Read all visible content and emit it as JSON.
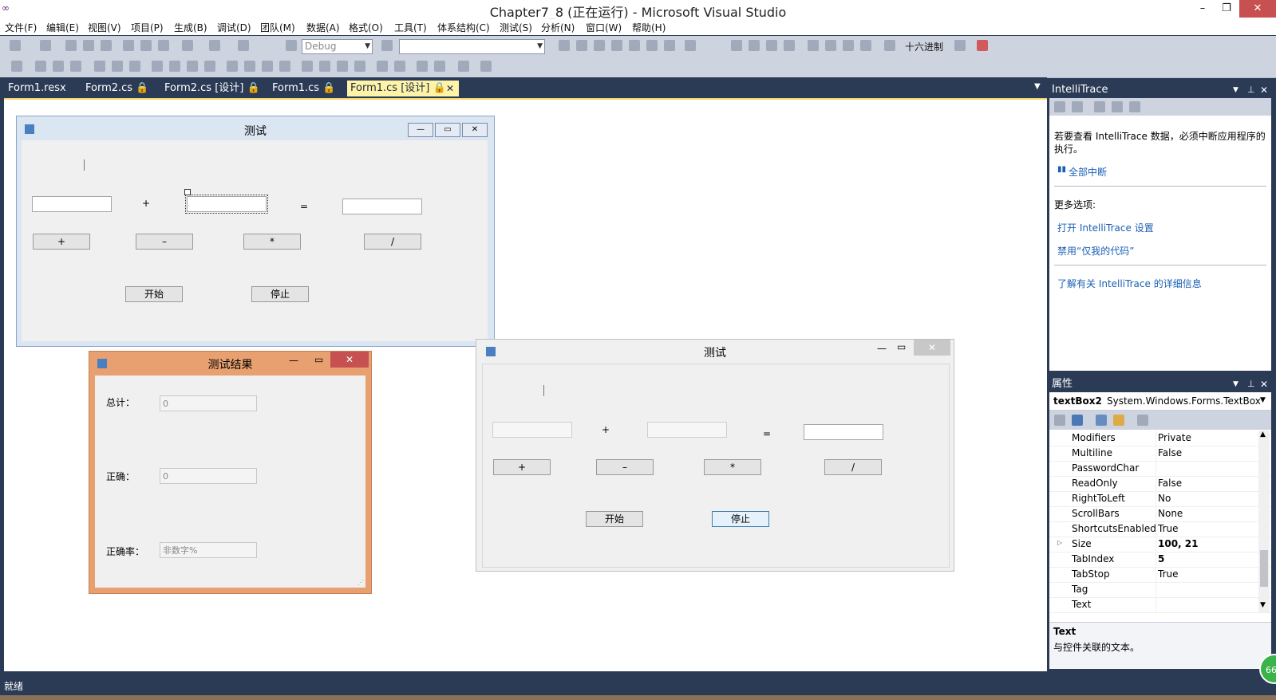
{
  "window": {
    "title": "Chapter7_8 (正在运行) - Microsoft Visual Studio",
    "min": "–",
    "max": "❐",
    "close": "✕"
  },
  "menu": [
    "文件(F)",
    "编辑(E)",
    "视图(V)",
    "项目(P)",
    "生成(B)",
    "调试(D)",
    "团队(M)",
    "数据(A)",
    "格式(O)",
    "工具(T)",
    "体系结构(C)",
    "测试(S)",
    "分析(N)",
    "窗口(W)",
    "帮助(H)"
  ],
  "toolbar": {
    "config": "Debug",
    "hex_label": "十六进制"
  },
  "tabs": [
    {
      "label": "Form1.resx",
      "active": false
    },
    {
      "label": "Form2.cs 🔒",
      "active": false
    },
    {
      "label": "Form2.cs [设计] 🔒",
      "active": false
    },
    {
      "label": "Form1.cs 🔒",
      "active": false
    },
    {
      "label": "Form1.cs [设计] 🔒",
      "active": true
    }
  ],
  "tab_close": "✕",
  "design_form": {
    "title": "测试",
    "plus_label": "+",
    "equals_label": "=",
    "btn_add": "+",
    "btn_sub": "–",
    "btn_mul": "*",
    "btn_div": "/",
    "btn_start": "开始",
    "btn_stop": "停止"
  },
  "result_form": {
    "title": "测试结果",
    "total_label": "总计：",
    "total_value": "0",
    "correct_label": "正确：",
    "correct_value": "0",
    "rate_label": "正确率：",
    "rate_value": "非数字%"
  },
  "run_form": {
    "title": "测试",
    "plus_label": "+",
    "equals_label": "=",
    "btn_add": "+",
    "btn_sub": "–",
    "btn_mul": "*",
    "btn_div": "/",
    "btn_start": "开始",
    "btn_stop": "停止"
  },
  "intellitrace": {
    "title": "IntelliTrace",
    "message": "若要查看 IntelliTrace 数据，必须中断应用程序的执行。",
    "break_all": "全部中断",
    "more_options": "更多选项:",
    "open_settings": "打开 IntelliTrace 设置",
    "disable_jmc": "禁用“仅我的代码”",
    "learn_more": "了解有关 IntelliTrace 的详细信息"
  },
  "properties": {
    "title": "属性",
    "object_name": "textBox2",
    "object_type": "System.Windows.Forms.TextBox",
    "rows": [
      {
        "name": "Modifiers",
        "value": "Private",
        "bold": false
      },
      {
        "name": "Multiline",
        "value": "False",
        "bold": false
      },
      {
        "name": "PasswordChar",
        "value": "",
        "bold": false
      },
      {
        "name": "ReadOnly",
        "value": "False",
        "bold": false
      },
      {
        "name": "RightToLeft",
        "value": "No",
        "bold": false
      },
      {
        "name": "ScrollBars",
        "value": "None",
        "bold": false
      },
      {
        "name": "ShortcutsEnabled",
        "value": "True",
        "bold": false
      },
      {
        "name": "Size",
        "value": "100, 21",
        "bold": true
      },
      {
        "name": "TabIndex",
        "value": "5",
        "bold": true
      },
      {
        "name": "TabStop",
        "value": "True",
        "bold": false
      },
      {
        "name": "Tag",
        "value": "",
        "bold": false
      },
      {
        "name": "Text",
        "value": "",
        "bold": false
      }
    ],
    "desc_title": "Text",
    "desc_text": "与控件关联的文本。"
  },
  "status": {
    "text": "就绪",
    "badge": "66"
  },
  "colors": {
    "vs_dark": "#2b3a55",
    "active_tab": "#fff3a8",
    "result_form_border": "#e8a070",
    "close_red": "#c75050"
  }
}
